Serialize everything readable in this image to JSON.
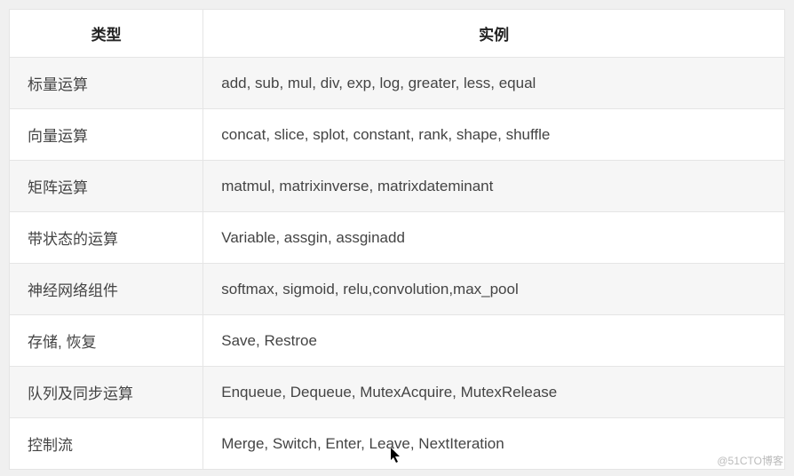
{
  "table": {
    "headers": {
      "type": "类型",
      "example": "实例"
    },
    "rows": [
      {
        "type": "标量运算",
        "example": "add, sub, mul, div, exp, log, greater, less, equal"
      },
      {
        "type": "向量运算",
        "example": "concat, slice, splot, constant, rank, shape, shuffle"
      },
      {
        "type": "矩阵运算",
        "example": "matmul, matrixinverse, matrixdateminant"
      },
      {
        "type": "带状态的运算",
        "example": "Variable, assgin, assginadd"
      },
      {
        "type": "神经网络组件",
        "example": "softmax, sigmoid, relu,convolution,max_pool"
      },
      {
        "type": "存储, 恢复",
        "example": "Save, Restroe"
      },
      {
        "type": "队列及同步运算",
        "example": "Enqueue, Dequeue, MutexAcquire, MutexRelease"
      },
      {
        "type": "控制流",
        "example": "Merge, Switch, Enter, Leave, NextIteration"
      }
    ]
  },
  "watermark": "@51CTO博客"
}
